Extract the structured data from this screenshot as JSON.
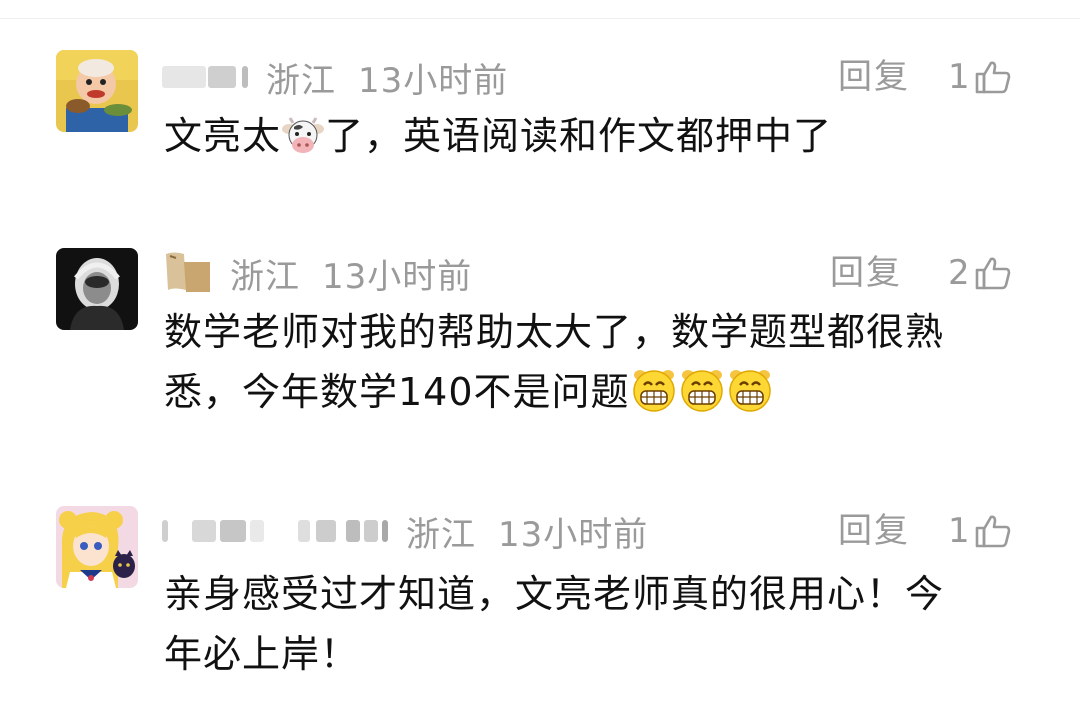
{
  "comments": [
    {
      "region": "浙江",
      "time": "13小时前",
      "reply_label": "回复",
      "likes": "1",
      "text_parts": [
        "文亮太",
        "了，英语阅读和作文都押中了"
      ],
      "emoji_names": [
        "cow-face-emoji"
      ]
    },
    {
      "region": "浙江",
      "time": "13小时前",
      "reply_label": "回复",
      "likes": "2",
      "line1": "数学老师对我的帮助太大了，数学题型都很熟",
      "line2": "悉，今年数学140不是问题",
      "emoji_names": [
        "grinning-face-emoji",
        "grinning-face-emoji",
        "grinning-face-emoji"
      ]
    },
    {
      "region": "浙江",
      "time": "13小时前",
      "reply_label": "回复",
      "likes": "1",
      "line1": "亲身感受过才知道，文亮老师真的很用心！今",
      "line2": "年必上岸！"
    }
  ],
  "colors": {
    "meta_text": "#9a9a9a",
    "content_text": "#111111",
    "background": "#ffffff"
  },
  "icons": [
    "thumbs-up-icon"
  ]
}
